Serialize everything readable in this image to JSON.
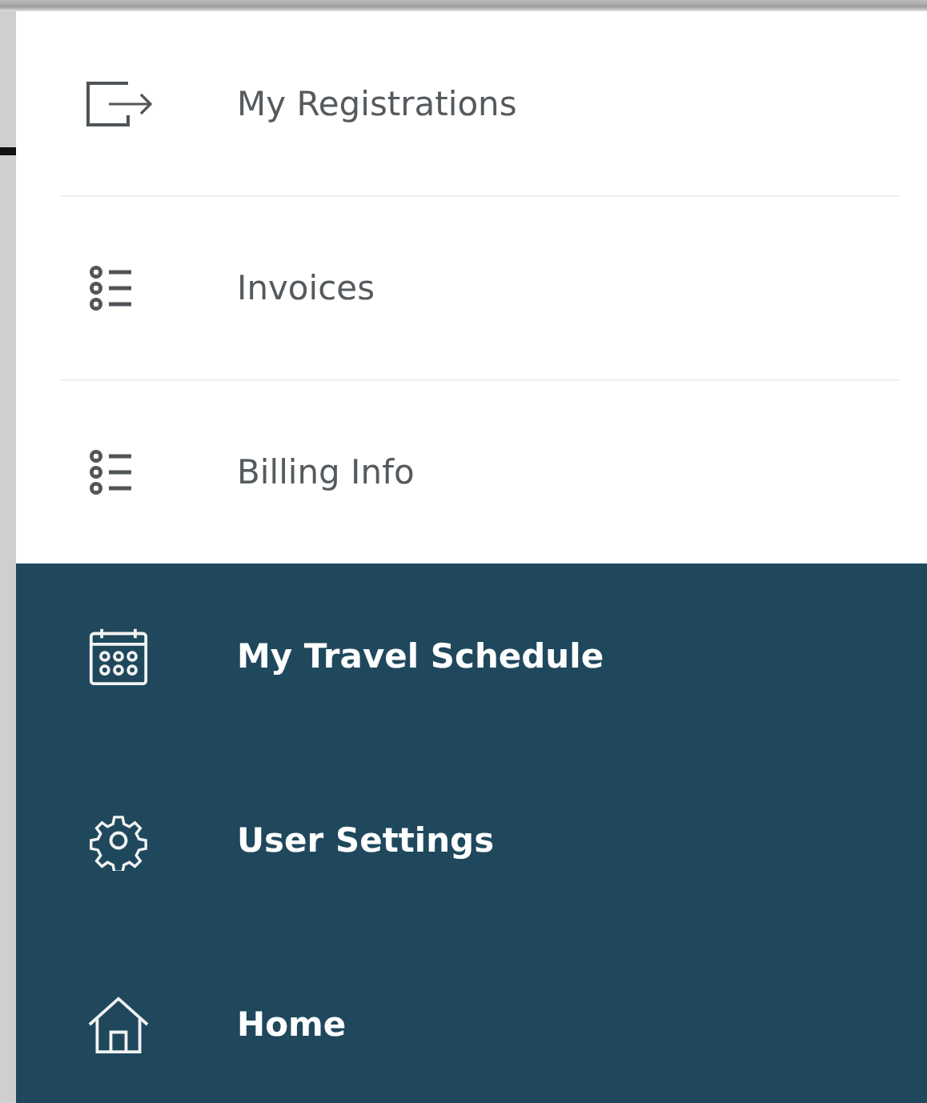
{
  "menu": {
    "items": [
      {
        "label": "My Registrations",
        "kind": "light"
      },
      {
        "label": "Invoices",
        "kind": "light"
      },
      {
        "label": "Billing Info",
        "kind": "light"
      },
      {
        "label": "My Travel Schedule",
        "kind": "dark"
      },
      {
        "label": "User Settings",
        "kind": "dark"
      },
      {
        "label": "Home",
        "kind": "dark"
      }
    ]
  }
}
